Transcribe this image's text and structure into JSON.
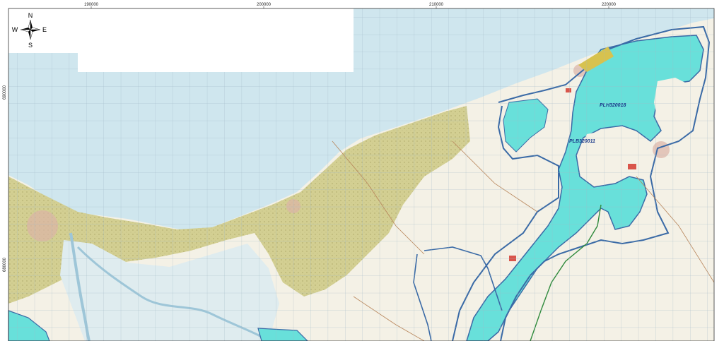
{
  "map": {
    "x_ticks": [
      "190000",
      "200000",
      "210000",
      "220000"
    ],
    "y_ticks": [
      "690000",
      "680000"
    ],
    "zones": [
      "PLH320018",
      "PLB320011"
    ],
    "compass": {
      "n": "N",
      "s": "S",
      "e": "E",
      "w": "W"
    }
  },
  "colors": {
    "sea": "#cfe6ee",
    "land_forest": "#d3cf92",
    "land_open": "#f4f1e6",
    "lagoon": "#68e0da",
    "boundary": "#3a6aa6",
    "grid": "#9fb7c6"
  }
}
